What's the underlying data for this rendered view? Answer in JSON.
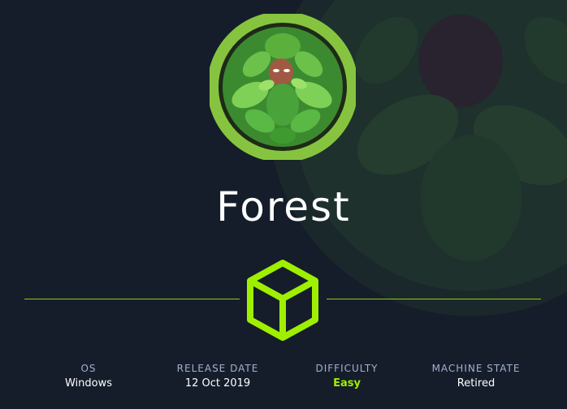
{
  "machine": {
    "name": "Forest",
    "emblem_icon": "green-hexagon-box-icon",
    "avatar": "forest-leaf-mask-avatar"
  },
  "details": [
    {
      "label": "OS",
      "value": "Windows"
    },
    {
      "label": "RELEASE DATE",
      "value": "12 Oct 2019"
    },
    {
      "label": "DIFFICULTY",
      "value": "Easy",
      "color": "#9fef00"
    },
    {
      "label": "MACHINE STATE",
      "value": "Retired"
    }
  ],
  "colors": {
    "background": "#151d2b",
    "accent": "#9fef00",
    "label": "#a4b1cd"
  }
}
